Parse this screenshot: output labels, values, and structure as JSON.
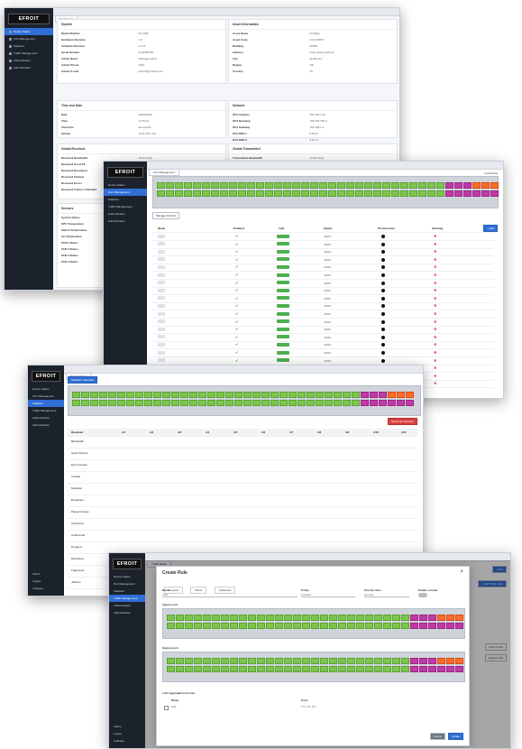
{
  "brand": "EFROIT",
  "nav": [
    "Device Status",
    "Port Management",
    "Statistics",
    "Traffic Management",
    "Authentication",
    "Administration"
  ],
  "nav_bottom": [
    "Admin",
    "Logout",
    "Collapse"
  ],
  "window1": {
    "tab": "Dashboard",
    "system_title": "System",
    "system_rows": [
      {
        "k": "Model Number",
        "v": "ST-4000"
      },
      {
        "k": "Hardware Revision",
        "v": "1.0"
      },
      {
        "k": "Software Revision",
        "v": "2.0.11"
      },
      {
        "k": "Serial Number",
        "v": "0123456789"
      },
      {
        "k": "Admin Name",
        "v": "Package Admin"
      },
      {
        "k": "Admin Phone",
        "v": "1234"
      },
      {
        "k": "Admin E-mail",
        "v": "admin@profitap.com"
      }
    ],
    "asset_title": "Asset Information",
    "asset_rows": [
      {
        "k": "Asset Name",
        "v": "ProfiMgt"
      },
      {
        "k": "Asset Code",
        "v": "AT-1234567"
      },
      {
        "k": "Building",
        "v": "PRBM"
      },
      {
        "k": "Address",
        "v": "Fake Street Address"
      },
      {
        "k": "City",
        "v": "Eindhoven"
      },
      {
        "k": "Region",
        "v": "NB"
      },
      {
        "k": "Country",
        "v": "NL"
      }
    ],
    "time_title": "Time and Date",
    "time_rows": [
      {
        "k": "Date",
        "v": "2020/06/09"
      },
      {
        "k": "Time",
        "v": "17:05:01"
      },
      {
        "k": "Timezone",
        "v": "Europe/NL"
      },
      {
        "k": "Uptime",
        "v": "1d 4h 22m 12s"
      }
    ],
    "network_title": "Network",
    "network_rows": [
      {
        "k": "IPv4 Address",
        "v": "192.168.1.10"
      },
      {
        "k": "IPv4 Netmask",
        "v": "255.255.255.0"
      },
      {
        "k": "IPv4 Gateway",
        "v": "192.168.1.1"
      },
      {
        "k": "IPv4 DNS 1",
        "v": "8.8.8.8"
      },
      {
        "k": "IPv4 DNS 2",
        "v": "8.8.4.4"
      }
    ],
    "netrecv_title": "Global Received",
    "netrecv_rows": [
      {
        "k": "Received Bandwidth",
        "v": "10.00 Gbps"
      },
      {
        "k": "Received Good All",
        "v": "1,234,567,890"
      },
      {
        "k": "Received Broadcast",
        "v": "123,456,789"
      },
      {
        "k": "Received Packets",
        "v": "234,567,890"
      },
      {
        "k": "Received Errors",
        "v": "0"
      },
      {
        "k": "Received Frames Unlimited",
        "v": "0"
      }
    ],
    "nettx_title": "Global Transmitted",
    "nettx_rows": [
      {
        "k": "Transmitted Bandwidth",
        "v": "10.00 Gbps"
      },
      {
        "k": "Transmitted Unicast",
        "v": "987,654,321"
      },
      {
        "k": "Transmitted Broadcast",
        "v": "98,765,432"
      },
      {
        "k": "Transmitted Packets",
        "v": "876,543,210"
      },
      {
        "k": "Transmitted Errors",
        "v": "0"
      },
      {
        "k": "Transmitted Collisions",
        "v": "0"
      }
    ],
    "sensors_title": "Sensors",
    "sensors_rows": [
      {
        "k": "System Status",
        "v": "OK"
      },
      {
        "k": "CPU Temperature",
        "v": "45 °C"
      },
      {
        "k": "Switch Temperature",
        "v": "52 °C"
      },
      {
        "k": "Air Temperature",
        "v": "31 °C"
      },
      {
        "k": "FAN 1 Status",
        "v": "OK"
      },
      {
        "k": "FAN 2 Status",
        "v": "OK"
      },
      {
        "k": "FAN 3 Status",
        "v": "OK"
      },
      {
        "k": "FAN 4 Status",
        "v": "OK"
      }
    ]
  },
  "window2": {
    "tab": "Port Management",
    "legend": "Link/Activity",
    "manage_button": "Manage Portlists",
    "add_button": "+ Add",
    "columns": [
      "Name",
      "Enabled",
      "Link",
      "Speed",
      "Promiscuous",
      "Autoneg"
    ],
    "speed_value": "10Gb",
    "mode_value": "xfl200"
  },
  "window3": {
    "tab": "Port Statistics",
    "filter_button": "Statistics Selection",
    "reset_button": "Reset All Counters",
    "col_headers": [
      "1/1",
      "1/2",
      "1/3",
      "1/4",
      "1/5",
      "1/6",
      "1/7",
      "1/8",
      "1/9",
      "1/10",
      "1/11"
    ],
    "received_label": "Received",
    "transmitted_label": "Transmitted",
    "rows": [
      "Bandwidth",
      "Good Frames",
      "Error Frames",
      "Unicast",
      "Multicast",
      "Broadcast",
      "Pause Frames",
      "Oversized",
      "Undersized",
      "Dropped",
      "Discarded",
      "Fragments",
      "Jabbers"
    ]
  },
  "window4": {
    "tab": "Traffic Rules",
    "dialog_title": "Create Rule",
    "dialog_tabs": [
      "General",
      "Filters",
      "Advanced"
    ],
    "name_label": "Name",
    "name_value": "rule1",
    "policy_label": "Policy",
    "policy_value": "Forward",
    "priority_label": "Priority class",
    "priority_value": "Normal",
    "enable_label": "Enable counter",
    "ingress_label": "Ingress port",
    "egress_label": "Output ports",
    "agg_label": "LAG Aggregation Groups",
    "agg_cols": [
      "Name",
      "Ports"
    ],
    "agg_row": {
      "name": "lag1",
      "ports": "1/1, 1/2, 1/3"
    },
    "cancel": "Cancel",
    "create": "Create",
    "side_buttons": [
      "+ Add",
      "+ Add Traffic Rule",
      "Import rules",
      "Export rules"
    ]
  }
}
